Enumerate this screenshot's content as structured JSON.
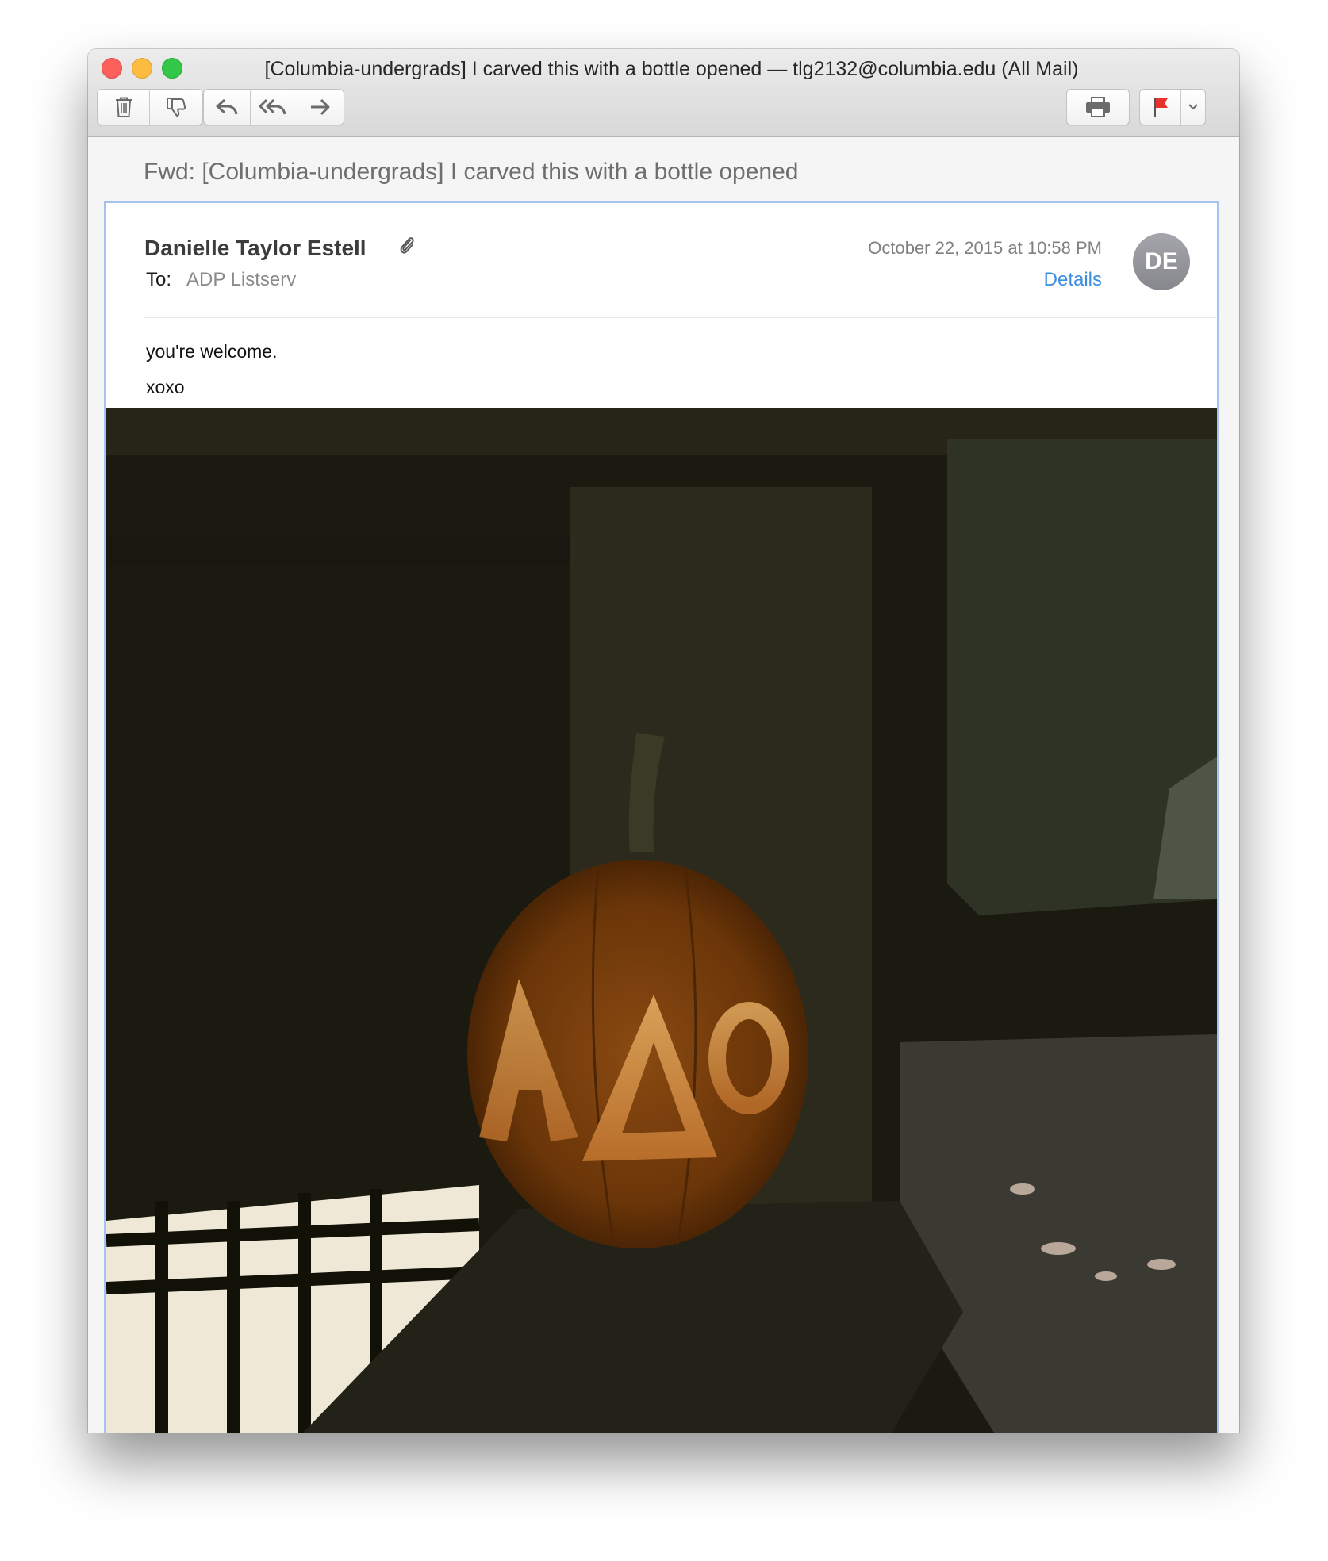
{
  "window": {
    "title": "[Columbia-undergrads] I carved this with a bottle opened — tlg2132@columbia.edu (All Mail)"
  },
  "toolbar": {
    "delete_icon": "trash-icon",
    "junk_icon": "thumbs-down-icon",
    "reply_icon": "reply-arrow-icon",
    "reply_all_icon": "reply-all-arrow-icon",
    "forward_icon": "forward-arrow-icon",
    "print_icon": "printer-icon",
    "flag_icon": "red-flag-icon",
    "flag_menu_icon": "chevron-down-icon",
    "flag_color": "#e8322c"
  },
  "message": {
    "subject": "Fwd: [Columbia-undergrads] I carved this with a bottle opened",
    "sender": "Danielle Taylor Estell",
    "attachment_icon": "paperclip-icon",
    "to_label": "To:",
    "to_value": "ADP Listserv",
    "date": "October 22, 2015 at 10:58 PM",
    "details_label": "Details",
    "avatar_initials": "DE",
    "accent_color": "#3d8ee0",
    "body_lines": [
      "you're welcome.",
      "xoxo"
    ],
    "image_subject": "photo of carved jack-o'-lantern pumpkin with Greek letters"
  }
}
